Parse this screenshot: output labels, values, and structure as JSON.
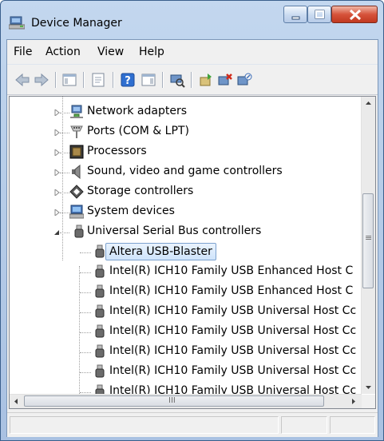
{
  "window": {
    "title": "Device Manager"
  },
  "menu": [
    "File",
    "Action",
    "View",
    "Help"
  ],
  "toolbar": {
    "buttons": [
      "back-icon",
      "forward-icon",
      "show-hide-console-tree-icon",
      "properties-icon",
      "help-icon",
      "action-pane-icon",
      "scan-hardware-icon",
      "update-driver-icon",
      "uninstall-icon",
      "disable-device-icon"
    ]
  },
  "tree": {
    "categories": [
      {
        "label": "Network adapters",
        "icon": "network-adapter-icon",
        "expanded": false
      },
      {
        "label": "Ports (COM & LPT)",
        "icon": "port-icon",
        "expanded": false
      },
      {
        "label": "Processors",
        "icon": "processor-icon",
        "expanded": false
      },
      {
        "label": "Sound, video and game controllers",
        "icon": "speaker-icon",
        "expanded": false
      },
      {
        "label": "Storage controllers",
        "icon": "storage-controller-icon",
        "expanded": false
      },
      {
        "label": "System devices",
        "icon": "system-device-icon",
        "expanded": false
      },
      {
        "label": "Universal Serial Bus controllers",
        "icon": "usb-icon",
        "expanded": true
      }
    ],
    "usb_devices": [
      {
        "label": "Altera USB-Blaster",
        "selected": true
      },
      {
        "label": "Intel(R) ICH10 Family USB Enhanced Host C",
        "selected": false
      },
      {
        "label": "Intel(R) ICH10 Family USB Enhanced Host C",
        "selected": false
      },
      {
        "label": "Intel(R) ICH10 Family USB Universal Host Cc",
        "selected": false
      },
      {
        "label": "Intel(R) ICH10 Family USB Universal Host Cc",
        "selected": false
      },
      {
        "label": "Intel(R) ICH10 Family USB Universal Host Cc",
        "selected": false
      },
      {
        "label": "Intel(R) ICH10 Family USB Universal Host Cc",
        "selected": false
      },
      {
        "label": "Intel(R) ICH10 Family USB Universal Host Cc",
        "selected": false
      }
    ]
  },
  "scrollbar": {
    "h_thumb_grip": "III",
    "v_thumb_grip": "≡"
  },
  "colors": {
    "selection_border": "#7da2ce",
    "selection_fill": "#cfe4fb"
  }
}
